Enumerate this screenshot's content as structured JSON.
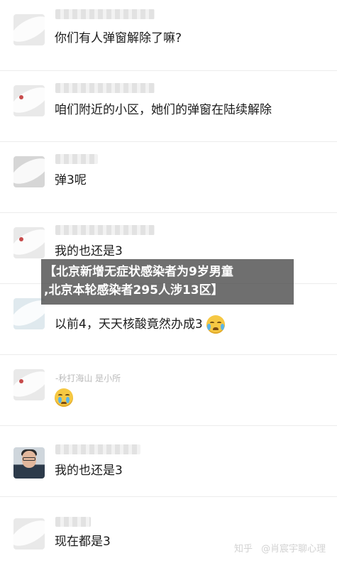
{
  "messages": [
    {
      "text": "你们有人弹窗解除了嘛?"
    },
    {
      "text": "咱们附近的小区，她们的弹窗在陆续解除"
    },
    {
      "text": "弹3呢"
    },
    {
      "text": "我的也还是3"
    },
    {
      "text": "以前4，天天核酸竟然办成3",
      "emoji": "crying-laughing-emoji"
    },
    {
      "text": "",
      "nickname_partial": "-秋打海山 是小所",
      "emoji": "crying-face-emoji"
    },
    {
      "text": "我的也还是3"
    },
    {
      "text": "现在都是3"
    }
  ],
  "banner": {
    "line1": "【北京新增无症状感染者为9岁男童",
    "line2": ",北京本轮感染者295人涉13区】"
  },
  "watermark": {
    "site": "知乎",
    "author": "@肖宸宇聊心理"
  },
  "colors": {
    "background": "#ffffff",
    "divider": "#ececec",
    "banner_bg": "#464646"
  }
}
